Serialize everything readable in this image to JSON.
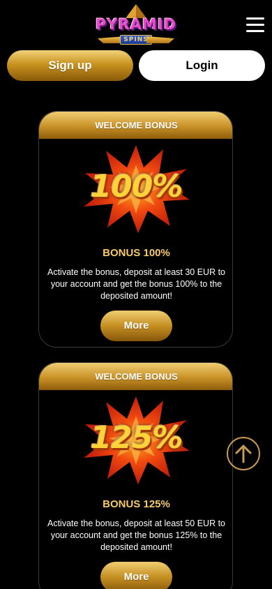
{
  "header": {
    "logo_title": "PYRAMID",
    "logo_subtitle": "SPINS"
  },
  "auth": {
    "signup_label": "Sign up",
    "login_label": "Login"
  },
  "bonuses": [
    {
      "header": "WELCOME BONUS",
      "badge": "100%",
      "title": "BONUS 100%",
      "description": "Activate the bonus, deposit at least 30 EUR to your account and get the bonus 100% to the deposited amount!",
      "button_label": "More"
    },
    {
      "header": "WELCOME BONUS",
      "badge": "125%",
      "title": "BONUS 125%",
      "description": "Activate the bonus, deposit at least 50 EUR to your account and get the bonus 125% to the deposited amount!",
      "button_label": "More"
    }
  ],
  "colors": {
    "background": "#000000",
    "gold": "#c8931f",
    "gold_text": "#f5cb6a",
    "burst_red": "#e0240c"
  },
  "icons": {
    "menu": "hamburger-menu-icon",
    "scroll_top": "arrow-up-circle-icon",
    "burst": "starburst-icon"
  }
}
